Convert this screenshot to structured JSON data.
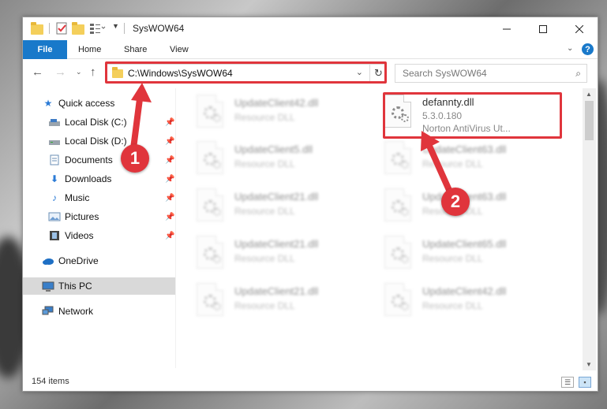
{
  "window": {
    "title": "SysWOW64"
  },
  "ribbon": {
    "file": "File",
    "home": "Home",
    "share": "Share",
    "view": "View",
    "help": "?"
  },
  "nav": {
    "address": "C:\\Windows\\SysWOW64",
    "search_placeholder": "Search SysWOW64"
  },
  "sidebar": {
    "items": [
      {
        "label": "Quick access",
        "icon": "star-icon"
      },
      {
        "label": "Local Disk (C:)",
        "icon": "drive-icon",
        "pinned": true
      },
      {
        "label": "Local Disk (D:)",
        "icon": "drive-icon",
        "pinned": true
      },
      {
        "label": "Documents",
        "icon": "documents-icon",
        "pinned": true
      },
      {
        "label": "Downloads",
        "icon": "download-icon",
        "pinned": true
      },
      {
        "label": "Music",
        "icon": "music-icon",
        "pinned": true
      },
      {
        "label": "Pictures",
        "icon": "pictures-icon",
        "pinned": true
      },
      {
        "label": "Videos",
        "icon": "videos-icon",
        "pinned": true
      },
      {
        "label": "OneDrive",
        "icon": "cloud-icon"
      },
      {
        "label": "This PC",
        "icon": "computer-icon",
        "selected": true
      },
      {
        "label": "Network",
        "icon": "network-icon"
      }
    ]
  },
  "files": {
    "highlighted": {
      "name": "defannty.dll",
      "version": "5.3.0.180",
      "description": "Norton AntiVirus Ut..."
    },
    "blurred": [
      {
        "name": "UpdateClient42.dll",
        "type": "Resource DLL"
      },
      {
        "name": "UpdateClient5.dll",
        "type": "Resource DLL"
      },
      {
        "name": "UpdateClient63.dll",
        "type": "Resource DLL"
      },
      {
        "name": "UpdateClient21.dll",
        "type": "Resource DLL"
      },
      {
        "name": "UpdateClient63.dll",
        "type": "Resource DLL"
      },
      {
        "name": "UpdateClient21.dll",
        "type": "Resource DLL"
      },
      {
        "name": "UpdateClient65.dll",
        "type": "Resource DLL"
      },
      {
        "name": "UpdateClient21.dll",
        "type": "Resource DLL"
      },
      {
        "name": "UpdateClient42.dll",
        "type": "Resource DLL"
      }
    ]
  },
  "status": {
    "items": "154 items"
  },
  "annotations": {
    "step1": "1",
    "step2": "2"
  },
  "colors": {
    "accent": "#1979ca",
    "highlight": "#e0353c"
  }
}
